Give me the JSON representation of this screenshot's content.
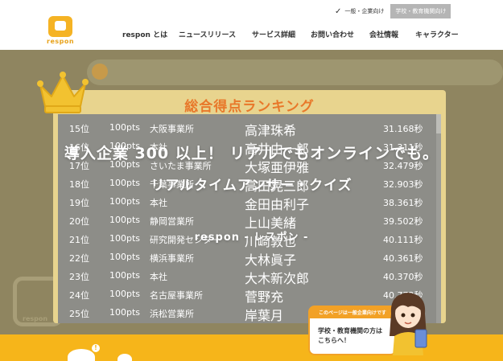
{
  "brand": {
    "logo_text": "respon"
  },
  "audience_switch": {
    "general": "一般・企業向け",
    "education": "学校・教育機関向け"
  },
  "nav": {
    "items": [
      {
        "label": "respon とは"
      },
      {
        "label": "ニュースリリース"
      },
      {
        "label": "サービス詳細"
      },
      {
        "label": "お問い合わせ"
      },
      {
        "label": "会社情報"
      },
      {
        "label": "キャラクター"
      }
    ]
  },
  "ranking": {
    "title": "総合得点ランキング",
    "rows": [
      {
        "rank": "15位",
        "pts": "100pts",
        "office": "大阪事業所",
        "name": "高津珠希",
        "time": "31.168秒"
      },
      {
        "rank": "16位",
        "pts": "100pts",
        "office": "本社",
        "name": "高井由一郎",
        "time": "31.311秒"
      },
      {
        "rank": "17位",
        "pts": "100pts",
        "office": "さいたま事業所",
        "name": "大塚亜伊雅",
        "time": "32.479秒"
      },
      {
        "rank": "18位",
        "pts": "100pts",
        "office": "千葉事業所",
        "name": "高田晃三郎",
        "time": "32.903秒"
      },
      {
        "rank": "19位",
        "pts": "100pts",
        "office": "本社",
        "name": "金田由利子",
        "time": "38.361秒"
      },
      {
        "rank": "20位",
        "pts": "100pts",
        "office": "静岡営業所",
        "name": "上山美緒",
        "time": "39.502秒"
      },
      {
        "rank": "21位",
        "pts": "100pts",
        "office": "研究開発センター",
        "name": "川崎敦也",
        "time": "40.111秒"
      },
      {
        "rank": "22位",
        "pts": "100pts",
        "office": "横浜事業所",
        "name": "大林眞子",
        "time": "40.361秒"
      },
      {
        "rank": "23位",
        "pts": "100pts",
        "office": "本社",
        "name": "大木新次郎",
        "time": "40.370秒"
      },
      {
        "rank": "24位",
        "pts": "100pts",
        "office": "名古屋事業所",
        "name": "菅野充",
        "time": "40.772秒"
      },
      {
        "rank": "25位",
        "pts": "100pts",
        "office": "浜松営業所",
        "name": "岸葉月",
        "time": "40.921秒"
      }
    ]
  },
  "hero": {
    "line1": "導入企業 300 以上！ リアルでもオンラインでも。",
    "line2": "リアルタイムアンサー・クイズ",
    "line3": "respon - レスポン -"
  },
  "floating_banner": {
    "top_text": "このページは一般企業向けです",
    "line1": "学校・教育機関の方は",
    "line2": "こちらへ！"
  },
  "colors": {
    "brand_yellow": "#f6b51a",
    "ranking_title": "#e8782a",
    "banner_orange": "#f2a126"
  },
  "icons": [
    "respon-logo",
    "check-icon",
    "crown-icon",
    "mascot-character"
  ]
}
